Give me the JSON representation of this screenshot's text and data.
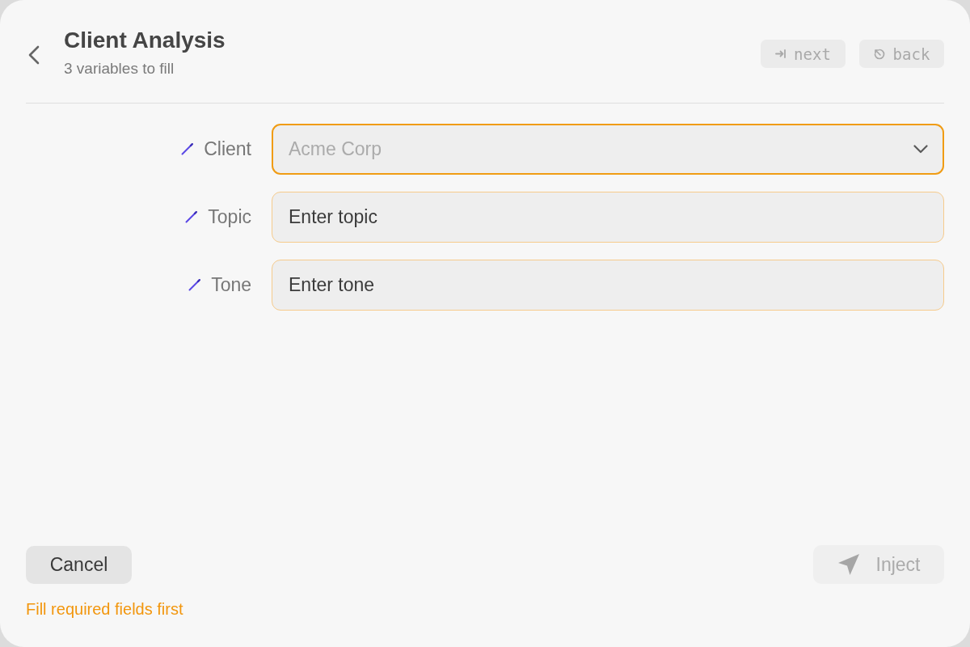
{
  "header": {
    "title": "Client Analysis",
    "subtitle": "3 variables to fill",
    "shortcuts": [
      {
        "kind": "tab",
        "label": "next"
      },
      {
        "kind": "escape",
        "label": "back"
      }
    ]
  },
  "fields": [
    {
      "kind": "select",
      "label": "Client",
      "placeholder": "Acme Corp",
      "focused": true,
      "required": true
    },
    {
      "kind": "text",
      "label": "Topic",
      "placeholder": "Enter topic",
      "focused": false,
      "required": true
    },
    {
      "kind": "text",
      "label": "Tone",
      "placeholder": "Enter tone",
      "focused": false,
      "required": true
    }
  ],
  "footer": {
    "cancel": "Cancel",
    "inject": {
      "label": "Inject",
      "disabled": true
    },
    "message": "Fill required fields first"
  }
}
